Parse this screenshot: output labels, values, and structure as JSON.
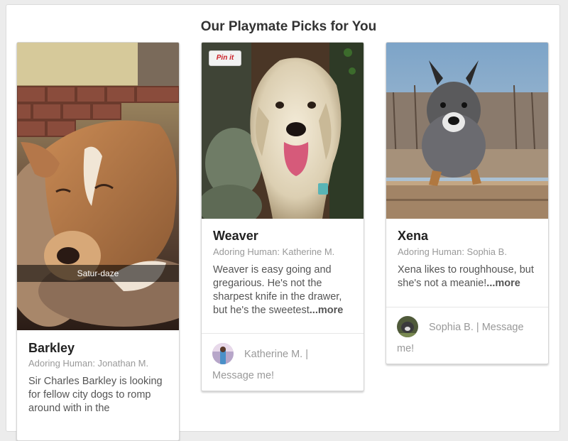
{
  "heading": "Our Playmate Picks for You",
  "cards": [
    {
      "name": "Barkley",
      "human": "Adoring Human: Jonathan M.",
      "description": "Sir Charles Barkley is looking for fellow city dogs to romp around with in the",
      "photo_caption": "Satur-daze"
    },
    {
      "name": "Weaver",
      "human": "Adoring Human: Katherine M.",
      "description": "Weaver is easy going and gregarious. He's not the sharpest knife in the drawer, but he's the sweetest",
      "more": "...more",
      "pin_label": "Pin it",
      "message_line1": "Katherine M. |",
      "message_line2": "Message me!"
    },
    {
      "name": "Xena",
      "human": "Adoring Human: Sophia B.",
      "description": "Xena likes to roughhouse, but she's not a meanie!",
      "more": "...more",
      "message_line1": "Sophia B. | Message",
      "message_line2": "me!"
    }
  ]
}
